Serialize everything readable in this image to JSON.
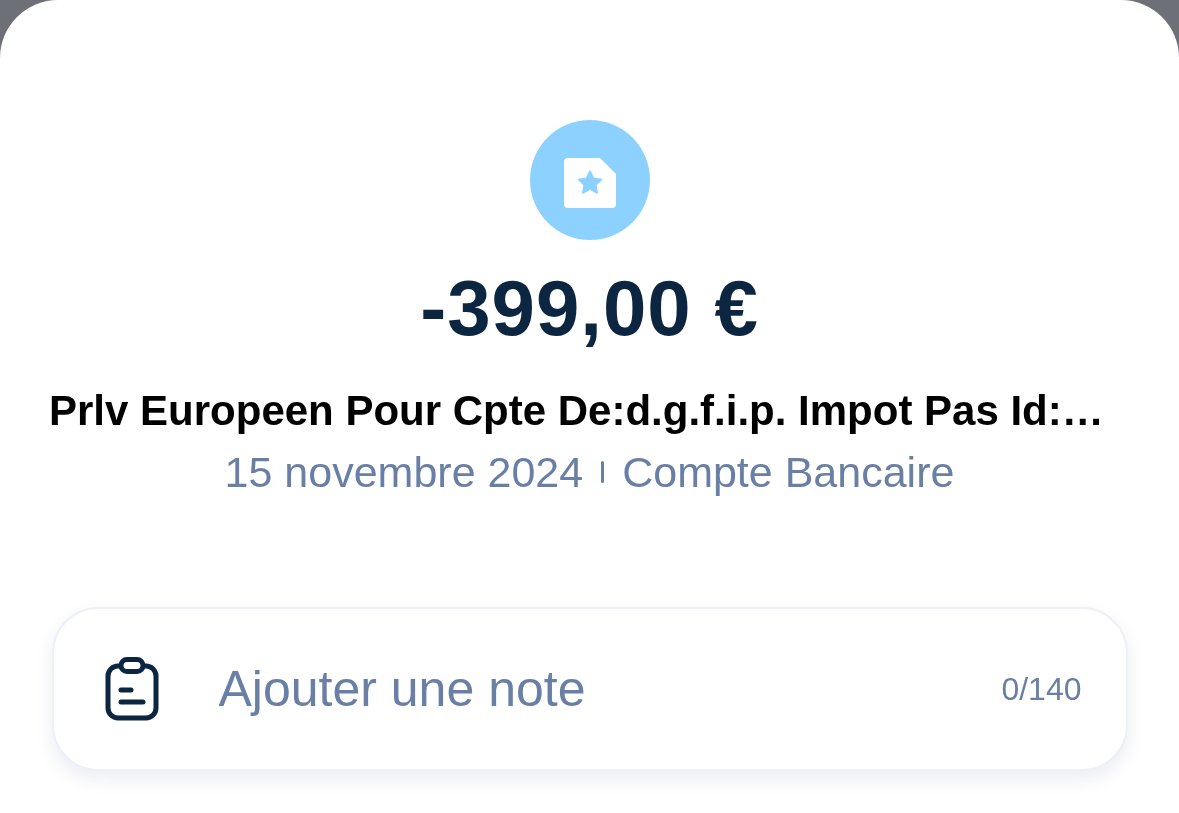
{
  "transaction": {
    "amount": "-399,00 €",
    "label": "Prlv Europeen Pour Cpte De:d.g.f.i.p. Impot Pas Id:…",
    "date": "15 novembre 2024",
    "account": "Compte Bancaire"
  },
  "note": {
    "placeholder": "Ajouter une note",
    "counter": "0/140"
  }
}
